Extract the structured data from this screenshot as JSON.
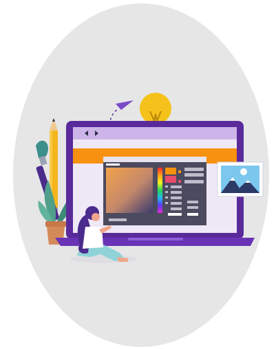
{
  "illustration": {
    "subject": "web-design-laptop",
    "icons": [
      "lightbulb-icon",
      "paper-plane-icon",
      "image-icon",
      "paintbrush-icon",
      "pencil-icon",
      "plant-icon",
      "color-picker-icon"
    ],
    "colors": {
      "background_blob": "#e6e6e7",
      "laptop_frame": "#5a2a9b",
      "laptop_base": "#6a33b5",
      "browser_bar": "#cdb5ea",
      "banner": "#f7910f",
      "screen": "#efe8f7",
      "picker_panel": "#4b4a5e",
      "bulb": "#f5c21b",
      "photo_frame_sky": "#7cc7ee",
      "mountains": "#2b3a67",
      "pot": "#d48a58",
      "leaves": "#4f9f8b",
      "woman_hair": "#4b2b8c",
      "woman_pants": "#8fd3d8"
    }
  }
}
